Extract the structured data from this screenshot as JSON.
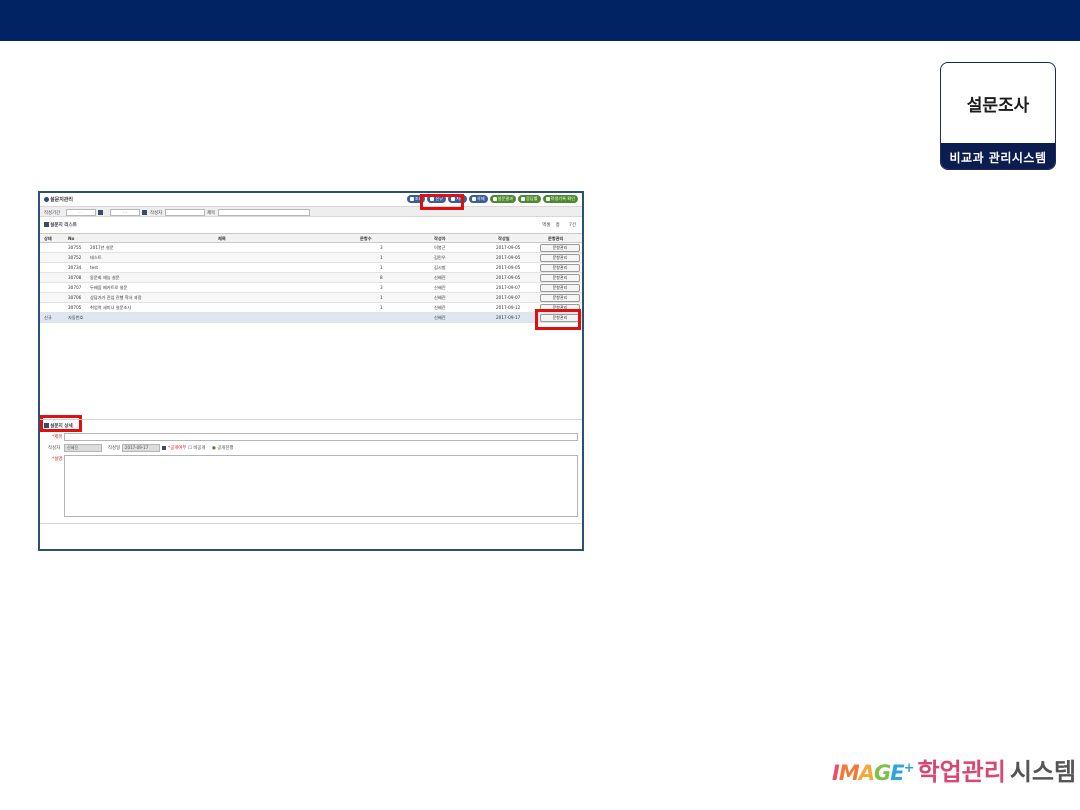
{
  "badge": {
    "title": "설문조사",
    "subtitle": "비교과 관리시스템"
  },
  "panel": {
    "title": "설문지관리",
    "toolbar": [
      {
        "label": "조회",
        "color": "blue"
      },
      {
        "label": "신규",
        "color": "blue"
      },
      {
        "label": "저장",
        "color": "blue"
      },
      {
        "label": "삭제",
        "color": "blue"
      },
      {
        "label": "설문결과",
        "color": "green"
      },
      {
        "label": "응답률",
        "color": "green"
      },
      {
        "label": "학생기록 확인",
        "color": "green"
      }
    ]
  },
  "filter": {
    "period_label": "작성기간",
    "date_from": "- -",
    "date_to": "- -",
    "author_label": "작성자",
    "title_label": "제목"
  },
  "list": {
    "label": "설문지 리스트",
    "tools": [
      "엑셀",
      "총",
      "7건"
    ],
    "columns": [
      "상태",
      "No",
      "제목",
      "문항수",
      "작성자",
      "작성일",
      "문항관리"
    ],
    "rows": [
      {
        "state": "",
        "no": "30755",
        "title": "2017년 설문",
        "count": "3",
        "author": "이봉근",
        "date": "2017-09-05",
        "btn": "문항관리"
      },
      {
        "state": "",
        "no": "30752",
        "title": "테스트",
        "count": "1",
        "author": "김민우",
        "date": "2017-09-05",
        "btn": "문항관리"
      },
      {
        "state": "",
        "no": "30734",
        "title": "test",
        "count": "1",
        "author": "김시험",
        "date": "2017-09-05",
        "btn": "문항관리"
      },
      {
        "state": "",
        "no": "30708",
        "title": "동문회 재능 설문",
        "count": "8",
        "author": "신혜진",
        "date": "2017-09-05",
        "btn": "문항관리"
      },
      {
        "state": "",
        "no": "30707",
        "title": "두배움 메카트로 설문",
        "count": "3",
        "author": "신혜진",
        "date": "2017-09-07",
        "btn": "문항관리"
      },
      {
        "state": "",
        "no": "30706",
        "title": "상담가가 진입 진행 학사 과정",
        "count": "1",
        "author": "신혜진",
        "date": "2017-09-07",
        "btn": "문항관리"
      },
      {
        "state": "",
        "no": "30705",
        "title": "취업역 세미나 설문조사",
        "count": "1",
        "author": "신혜진",
        "date": "2017-09-12",
        "btn": "문항관리"
      },
      {
        "state": "신규",
        "no": "자동번호",
        "title": "",
        "count": "",
        "author": "신혜진",
        "date": "2017-09-17",
        "btn": "문항관리"
      }
    ]
  },
  "detail": {
    "label": "설문지 상세",
    "title_label": "*제목",
    "author_label": "작성자",
    "author_value": "신혜진",
    "date_label": "작성일",
    "date_value": "2017-09-17",
    "public_label": "*공개여부",
    "options": [
      "비공개",
      "공개진행"
    ],
    "desc_label": "*설명"
  },
  "brand": {
    "logo": [
      "I",
      "M",
      "A",
      "G",
      "E"
    ],
    "plus": "+",
    "text1": "학업관리",
    "text2": "시스템"
  }
}
